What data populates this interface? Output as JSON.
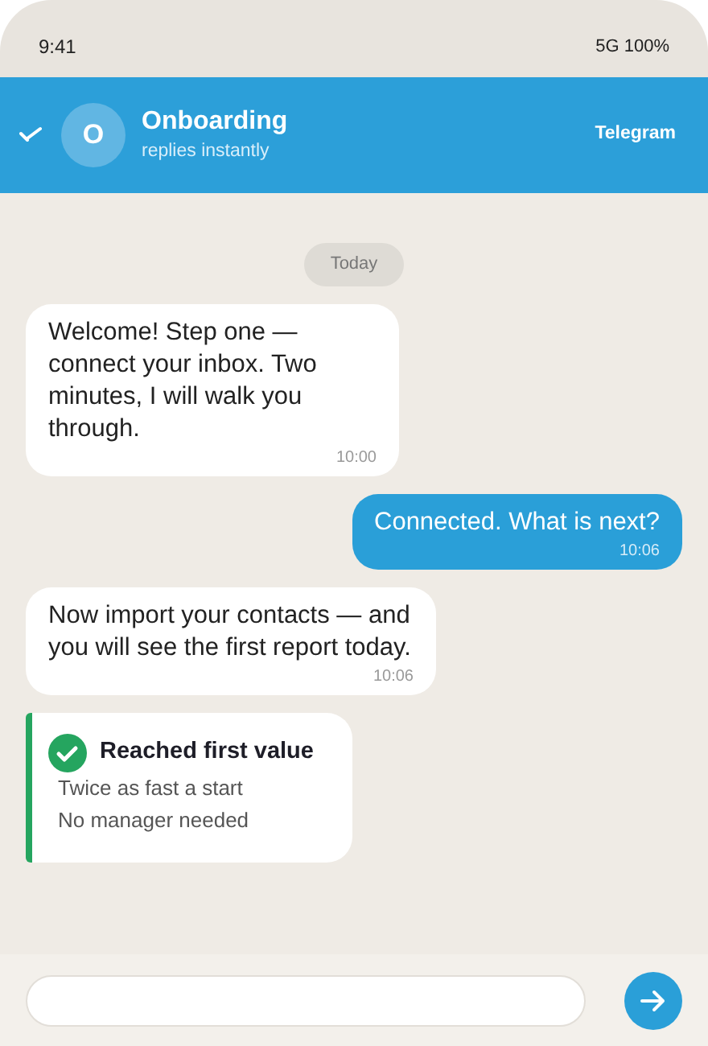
{
  "status_bar": {
    "time": "9:41",
    "indicators": "5G 100%"
  },
  "header": {
    "avatar_letter": "O",
    "title": "Onboarding",
    "subtitle": "replies instantly",
    "app": "Telegram"
  },
  "date_chip": "Today",
  "messages": [
    {
      "kind": "incoming",
      "text": "Welcome! Step one — connect your inbox. Two minutes, I will walk you through.",
      "time": "10:00"
    },
    {
      "kind": "outgoing",
      "text": "Connected. What is next?",
      "time": "10:06"
    },
    {
      "kind": "incoming",
      "text": "Now import your contacts — and you will see the first report today.",
      "time": "10:06"
    },
    {
      "kind": "card",
      "title": "Reached first value",
      "lines": [
        "Twice as fast a start",
        "No manager needed"
      ]
    }
  ]
}
